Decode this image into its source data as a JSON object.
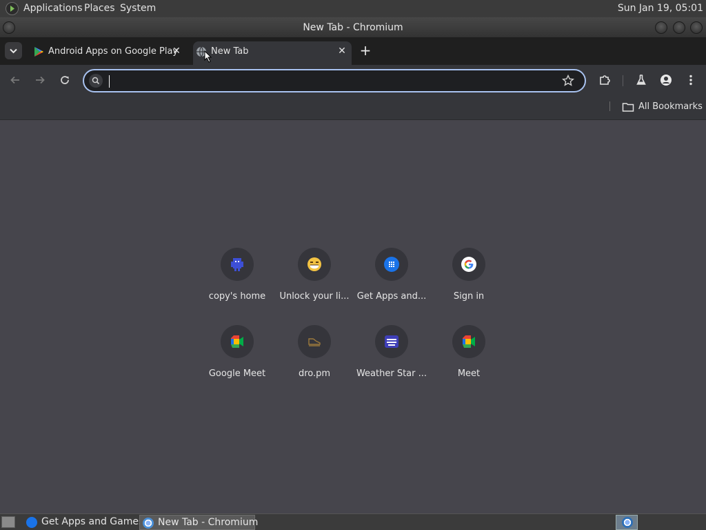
{
  "top_panel": {
    "menus": [
      "Applications",
      "Places",
      "System"
    ],
    "clock": "Sun Jan 19, 05:01"
  },
  "window": {
    "title": "New Tab - Chromium"
  },
  "tabs": [
    {
      "label": "Android Apps on Google Play",
      "icon": "google-play-icon",
      "active": false
    },
    {
      "label": "New Tab",
      "icon": "globe-icon",
      "active": true
    }
  ],
  "omnibox": {
    "value": "",
    "placeholder": ""
  },
  "bookmarks_bar": {
    "all_bookmarks_label": "All Bookmarks"
  },
  "shortcuts": [
    {
      "label": "copy's home",
      "icon": "pixel-creature-icon"
    },
    {
      "label": "Unlock your li...",
      "icon": "smiley-icon"
    },
    {
      "label": "Get Apps and...",
      "icon": "apps-grid-icon"
    },
    {
      "label": "Sign in",
      "icon": "google-g-icon"
    },
    {
      "label": "Google Meet",
      "icon": "meet-icon"
    },
    {
      "label": "dro.pm",
      "icon": "shoe-icon"
    },
    {
      "label": "Weather Star ...",
      "icon": "weather-channel-icon"
    },
    {
      "label": "Meet",
      "icon": "meet-icon"
    }
  ],
  "taskbar": {
    "tasks": [
      {
        "label": "Get Apps and Games",
        "active": false
      },
      {
        "label": "New Tab - Chromium",
        "active": true
      }
    ]
  },
  "colors": {
    "accent_focus_ring": "#a9c3f1",
    "page_background": "#46454c",
    "toolbar": "#35363a"
  }
}
